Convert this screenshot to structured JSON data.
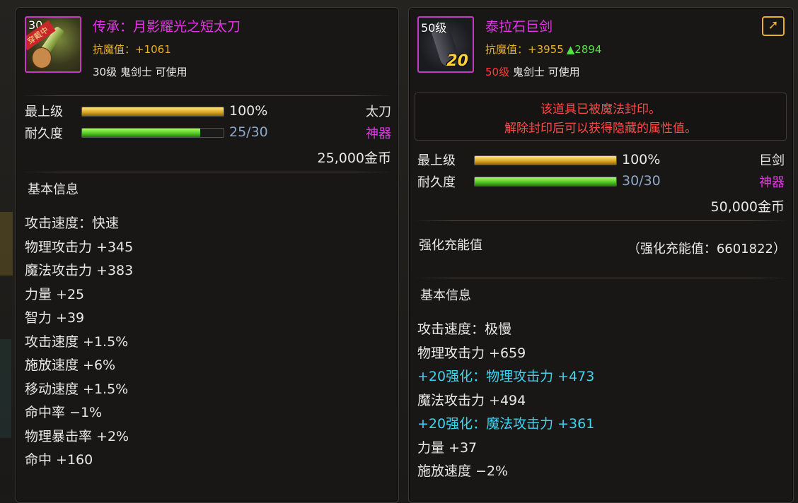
{
  "left": {
    "icon_level": "30",
    "equip_tag": "穿戴中",
    "name": "传承：月影耀光之短太刀",
    "resist_label": "抗魔值：",
    "resist_value": "+1061",
    "req_level": "30级",
    "req_rest": " 鬼剑士 可使用",
    "grade_label": "最上级",
    "grade_percent": 1.0,
    "grade_text": "100%",
    "durability_label": "耐久度",
    "durability_fraction": 0.833,
    "durability_text": "25/30",
    "type": "太刀",
    "rarity": "神器",
    "price": "25,000金币",
    "basic_title": "基本信息",
    "stats": [
      "攻击速度：快速",
      "物理攻击力 +345",
      "魔法攻击力 +383",
      "力量 +25",
      "智力 +39",
      "攻击速度 +1.5%",
      "施放速度 +6%",
      "移动速度 +1.5%",
      "命中率 −1%",
      "物理暴击率 +2%",
      "命中 +160"
    ]
  },
  "right": {
    "icon_level": "50级",
    "upgrade": "20",
    "name": "泰拉石巨剑",
    "resist_label": "抗魔值：",
    "resist_value": "+3955",
    "resist_diff": "▲2894",
    "req_level": "50级",
    "req_rest": " 鬼剑士 可使用",
    "share_icon": "share-icon",
    "seal_line1": "该道具已被魔法封印。",
    "seal_line2": "解除封印后可以获得隐藏的属性值。",
    "grade_label": "最上级",
    "grade_percent": 1.0,
    "grade_text": "100%",
    "durability_label": "耐久度",
    "durability_fraction": 1.0,
    "durability_text": "30/30",
    "type": "巨剑",
    "rarity": "神器",
    "price": "50,000金币",
    "reinforce_title": "强化充能值",
    "reinforce_value": "（强化充能值：6601822）",
    "basic_title": "基本信息",
    "stats": [
      {
        "text": "攻击速度：极慢",
        "cyan": false
      },
      {
        "text": "物理攻击力 +659",
        "cyan": false
      },
      {
        "text": "+20强化：物理攻击力 +473",
        "cyan": true
      },
      {
        "text": "魔法攻击力 +494",
        "cyan": false
      },
      {
        "text": "+20强化：魔法攻击力 +361",
        "cyan": true
      },
      {
        "text": "力量 +37",
        "cyan": false
      },
      {
        "text": "施放速度 −2%",
        "cyan": false
      }
    ]
  },
  "colors": {
    "rarity": "#e536e5",
    "resist": "#e8b12a",
    "seal_warning": "#ff4848",
    "reinforce_stat": "#3fd4f0",
    "req_level_unmet": "#ff3b3b"
  }
}
